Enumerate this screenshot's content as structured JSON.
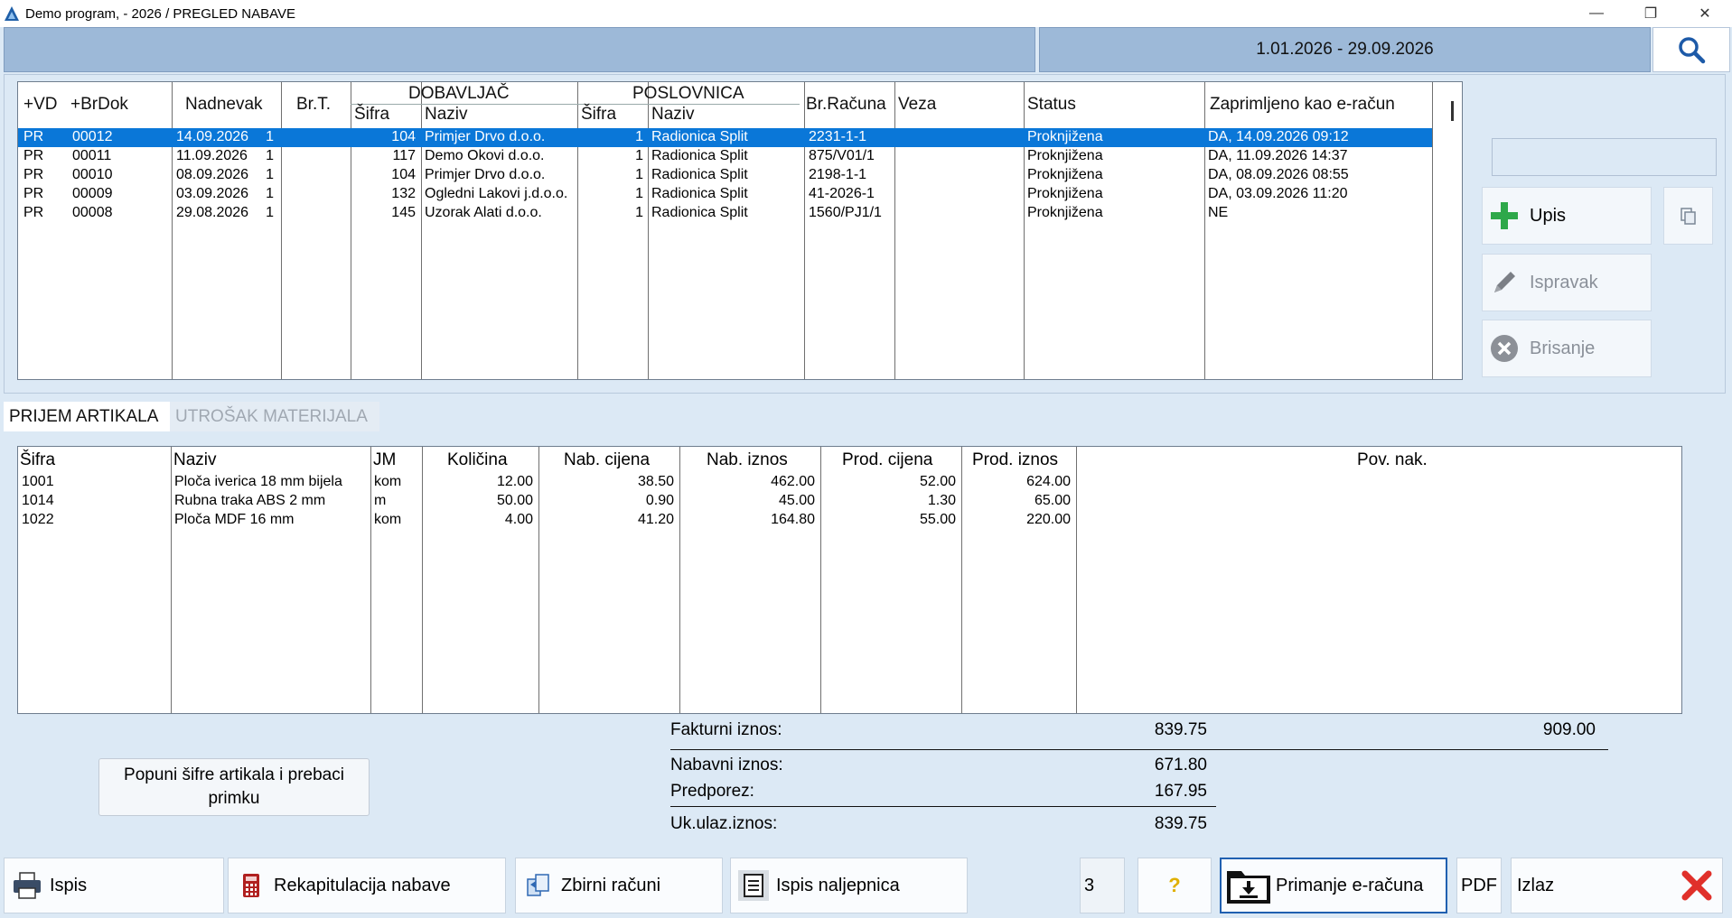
{
  "window": {
    "title": "Demo program, - 2026 / PREGLED NABAVE",
    "minimize": "—",
    "restore": "❐",
    "close": "✕"
  },
  "header": {
    "date_range": "1.01.2026 - 29.09.2026"
  },
  "icons": {
    "app": "app-logo-icon",
    "search": "search-icon",
    "add": "plus-icon",
    "copy": "copy-icon",
    "edit": "pencil-icon",
    "delete": "cancel-circle-icon",
    "print": "printer-icon",
    "calc": "calculator-icon",
    "transfer": "transfer-icon",
    "labels": "label-printer-icon",
    "help": "question-icon",
    "einvoice": "download-folder-icon",
    "exit": "red-x-icon"
  },
  "colors": {
    "selection": "#0a77d8",
    "banner": "#9db9d8",
    "add_green": "#2ea84a",
    "exit_red": "#e0302a"
  },
  "documents": {
    "headers": {
      "vd": "+VD",
      "brdok": "+BrDok",
      "nadnevak": "Nadnevak",
      "brt": "Br.T.",
      "dobavljac": "DOBAVLJAČ",
      "dob_sifra": "Šifra",
      "dob_naziv": "Naziv",
      "poslovnica": "POSLOVNICA",
      "pos_sifra": "Šifra",
      "pos_naziv": "Naziv",
      "brracuna": "Br.Računa",
      "veza": "Veza",
      "status": "Status",
      "eracun": "Zaprimljeno kao e-račun"
    },
    "rows": [
      {
        "vd": "PR",
        "brdok": "00012",
        "nadnevak": "14.09.2026",
        "brt": "1",
        "dob_sifra": "104",
        "dob_naziv": "Primjer Drvo d.o.o.",
        "pos_sifra": "1",
        "pos_naziv": "Radionica Split",
        "brracuna": "2231-1-1",
        "veza": "",
        "status": "Proknjižena",
        "eracun": "DA, 14.09.2026 09:12"
      },
      {
        "vd": "PR",
        "brdok": "00011",
        "nadnevak": "11.09.2026",
        "brt": "1",
        "dob_sifra": "117",
        "dob_naziv": "Demo Okovi d.o.o.",
        "pos_sifra": "1",
        "pos_naziv": "Radionica Split",
        "brracuna": "875/V01/1",
        "veza": "",
        "status": "Proknjižena",
        "eracun": "DA, 11.09.2026 14:37"
      },
      {
        "vd": "PR",
        "brdok": "00010",
        "nadnevak": "08.09.2026",
        "brt": "1",
        "dob_sifra": "104",
        "dob_naziv": "Primjer Drvo d.o.o.",
        "pos_sifra": "1",
        "pos_naziv": "Radionica Split",
        "brracuna": "2198-1-1",
        "veza": "",
        "status": "Proknjižena",
        "eracun": "DA, 08.09.2026 08:55"
      },
      {
        "vd": "PR",
        "brdok": "00009",
        "nadnevak": "03.09.2026",
        "brt": "1",
        "dob_sifra": "132",
        "dob_naziv": "Ogledni Lakovi j.d.o.o.",
        "pos_sifra": "1",
        "pos_naziv": "Radionica Split",
        "brracuna": "41-2026-1",
        "veza": "",
        "status": "Proknjižena",
        "eracun": "DA, 03.09.2026 11:20"
      },
      {
        "vd": "PR",
        "brdok": "00008",
        "nadnevak": "29.08.2026",
        "brt": "1",
        "dob_sifra": "145",
        "dob_naziv": "Uzorak Alati d.o.o.",
        "pos_sifra": "1",
        "pos_naziv": "Radionica Split",
        "brracuna": "1560/PJ1/1",
        "veza": "",
        "status": "Proknjižena",
        "eracun": "NE"
      }
    ]
  },
  "side": {
    "upis": "Upis",
    "ispravak": "Ispravak",
    "brisanje": "Brisanje"
  },
  "tabs": {
    "prijem": "PRIJEM ARTIKALA",
    "utrosak": "UTROŠAK MATERIJALA"
  },
  "items": {
    "headers": {
      "sifra": "Šifra",
      "naziv": "Naziv",
      "jm": "JM",
      "kolicina": "Količina",
      "nab_cijena": "Nab. cijena",
      "nab_iznos": "Nab. iznos",
      "prod_cijena": "Prod. cijena",
      "prod_iznos": "Prod. iznos",
      "pov_nak": "Pov. nak."
    },
    "rows": [
      {
        "sifra": "1001",
        "naziv": "Ploča iverica 18 mm bijela",
        "jm": "kom",
        "kolicina": "12.00",
        "nab_cijena": "38.50",
        "nab_iznos": "462.00",
        "prod_cijena": "52.00",
        "prod_iznos": "624.00"
      },
      {
        "sifra": "1014",
        "naziv": "Rubna traka ABS 2 mm",
        "jm": "m",
        "kolicina": "50.00",
        "nab_cijena": "0.90",
        "nab_iznos": "45.00",
        "prod_cijena": "1.30",
        "prod_iznos": "65.00"
      },
      {
        "sifra": "1022",
        "naziv": "Ploča MDF 16 mm",
        "jm": "kom",
        "kolicina": "4.00",
        "nab_cijena": "41.20",
        "nab_iznos": "164.80",
        "prod_cijena": "55.00",
        "prod_iznos": "220.00"
      }
    ]
  },
  "totals": {
    "fakturni_label": "Fakturni iznos:",
    "fakturni_value": "839.75",
    "fakturni_value2": "909.00",
    "nabavni_label": "Nabavni iznos:",
    "nabavni_value": "671.80",
    "predporez_label": "Predporez:",
    "predporez_value": "167.95",
    "ukulaz_label": "Uk.ulaz.iznos:",
    "ukulaz_value": "839.75"
  },
  "fill_button": {
    "line1": "Popuni šifre artikala i prebaci",
    "line2": "primku"
  },
  "bottom": {
    "ispis": "Ispis",
    "rekapitulacija": "Rekapitulacija nabave",
    "zbirni": "Zbirni računi",
    "naljepnica": "Ispis naljepnica",
    "counter": "3",
    "help": "?",
    "primanje": "Primanje e-računa",
    "pdf": "PDF",
    "izlaz": "Izlaz"
  }
}
